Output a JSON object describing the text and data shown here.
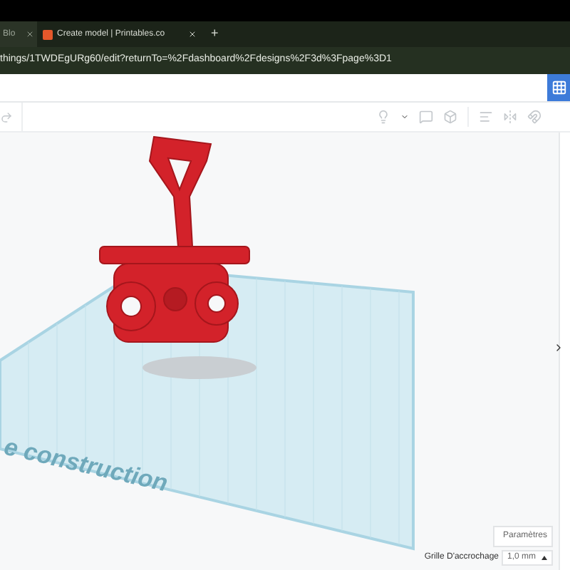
{
  "tabs": [
    {
      "title": "Blo",
      "selected": true
    },
    {
      "title": "Create model | Printables.co",
      "selected": false
    }
  ],
  "new_tab": "+",
  "address": "things/1TWDEgURg60/edit?returnTo=%2Fdashboard%2Fdesigns%2F3d%3Fpage%3D1",
  "workplane_label": "e construction",
  "settings_button": "Paramètres",
  "snap_grid": {
    "label": "Grille D'accrochage",
    "value": "1,0 mm"
  }
}
